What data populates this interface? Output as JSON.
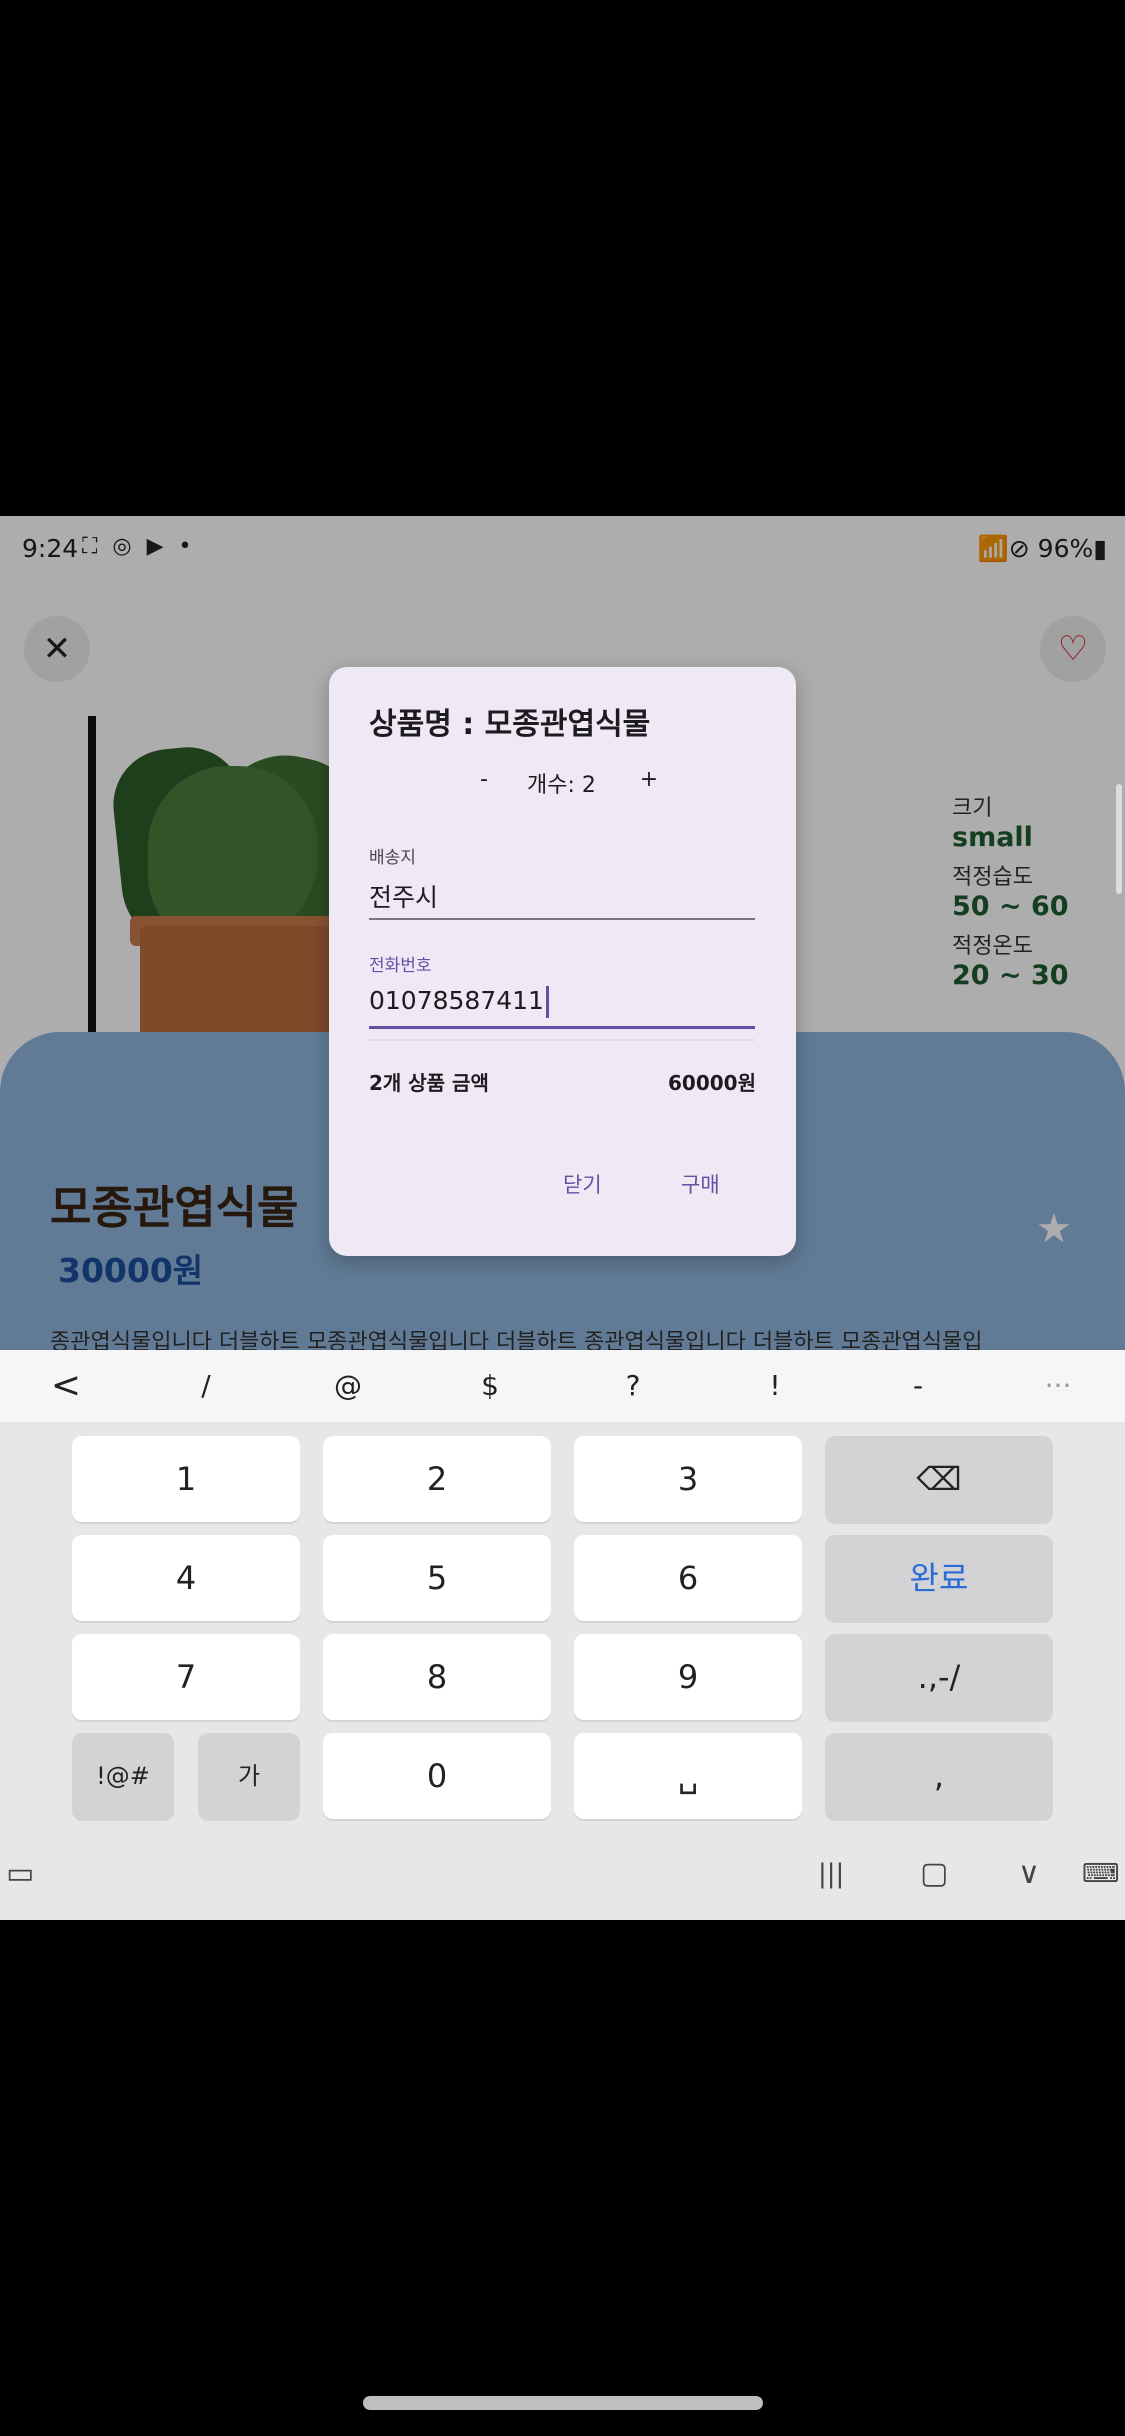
{
  "status_bar": {
    "time": "9:24",
    "left_icons": "⛶ ◎ ▶ •",
    "right_text": "📶⊘ 96%▮"
  },
  "product_page": {
    "name": "모종관엽식물",
    "price": "30000원",
    "specs": [
      {
        "label": "크기",
        "value": "small"
      },
      {
        "label": "적정습도",
        "value": "50 ~ 60"
      },
      {
        "label": "적정온도",
        "value": "20 ~ 30"
      }
    ],
    "description": "종관엽식물입니다 더블하트 모종관엽식물입니다 더블하트 종관엽식물입니다 더블하트 모종관엽식물입"
  },
  "dialog": {
    "title": "상품명 : 모종관엽식물",
    "qty_minus": "-",
    "qty_label": "개수: 2",
    "qty_plus": "+",
    "address_label": "배송지",
    "address_value": "전주시",
    "phone_label": "전화번호",
    "phone_value": "01078587411",
    "summary_label": "2개 상품 금액",
    "summary_value": "60000원",
    "close_label": "닫기",
    "buy_label": "구매"
  },
  "keyboard": {
    "toolbar": [
      "<",
      "/",
      "@",
      "$",
      "?",
      "!",
      "-",
      "···"
    ],
    "rows": [
      [
        "1",
        "2",
        "3",
        "⌫"
      ],
      [
        "4",
        "5",
        "6",
        "완료"
      ],
      [
        "7",
        "8",
        "9",
        ".,-/"
      ],
      [
        "!@#",
        "가",
        "0",
        "␣",
        ","
      ]
    ]
  },
  "nav": {
    "left_icon": "▭",
    "recent": "|||",
    "home": "▢",
    "back": "∨",
    "kbd": "⌨"
  },
  "colors": {
    "accent": "#6750a4",
    "card_bg": "#8fb5dd",
    "price": "#1a4f9a",
    "spec_value": "#1d5c2e",
    "dialog_bg": "#efe8f5"
  }
}
